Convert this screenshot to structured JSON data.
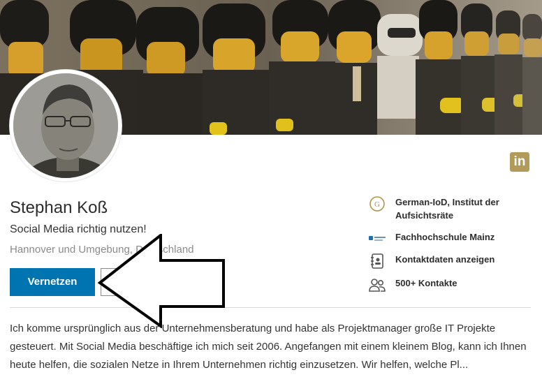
{
  "profile": {
    "name": "Stephan Koß",
    "headline": "Social Media richtig nutzen!",
    "location": "Hannover und Umgebung, Deutschland"
  },
  "actions": {
    "connect_label": "Vernetzen",
    "more_label": "···"
  },
  "network_icon": {
    "label": "in",
    "color": "#b29b5a"
  },
  "sidebar": {
    "items": [
      {
        "icon": "institute-logo-icon",
        "label": "German-IoD, Institut der Aufsichtsräte"
      },
      {
        "icon": "school-logo-icon",
        "label": "Fachhochschule Mainz"
      },
      {
        "icon": "contact-card-icon",
        "label": "Kontaktdaten anzeigen"
      },
      {
        "icon": "people-icon",
        "label": "500+ Kontakte"
      }
    ]
  },
  "about": {
    "text": "Ich komme ursprünglich aus der Unternehmensberatung und habe als Projektmanager große IT Projekte gesteuert. Mit Social Media beschäftige ich mich seit 2006. Angefangen mit einem kleinem Blog, kann ich Ihnen heute helfen, die sozialen Netze in Ihrem Unternehmen richtig einzusetzen. Wir helfen, welche Pl..."
  },
  "colors": {
    "primary": "#0073b1",
    "accent": "#b29b5a"
  }
}
